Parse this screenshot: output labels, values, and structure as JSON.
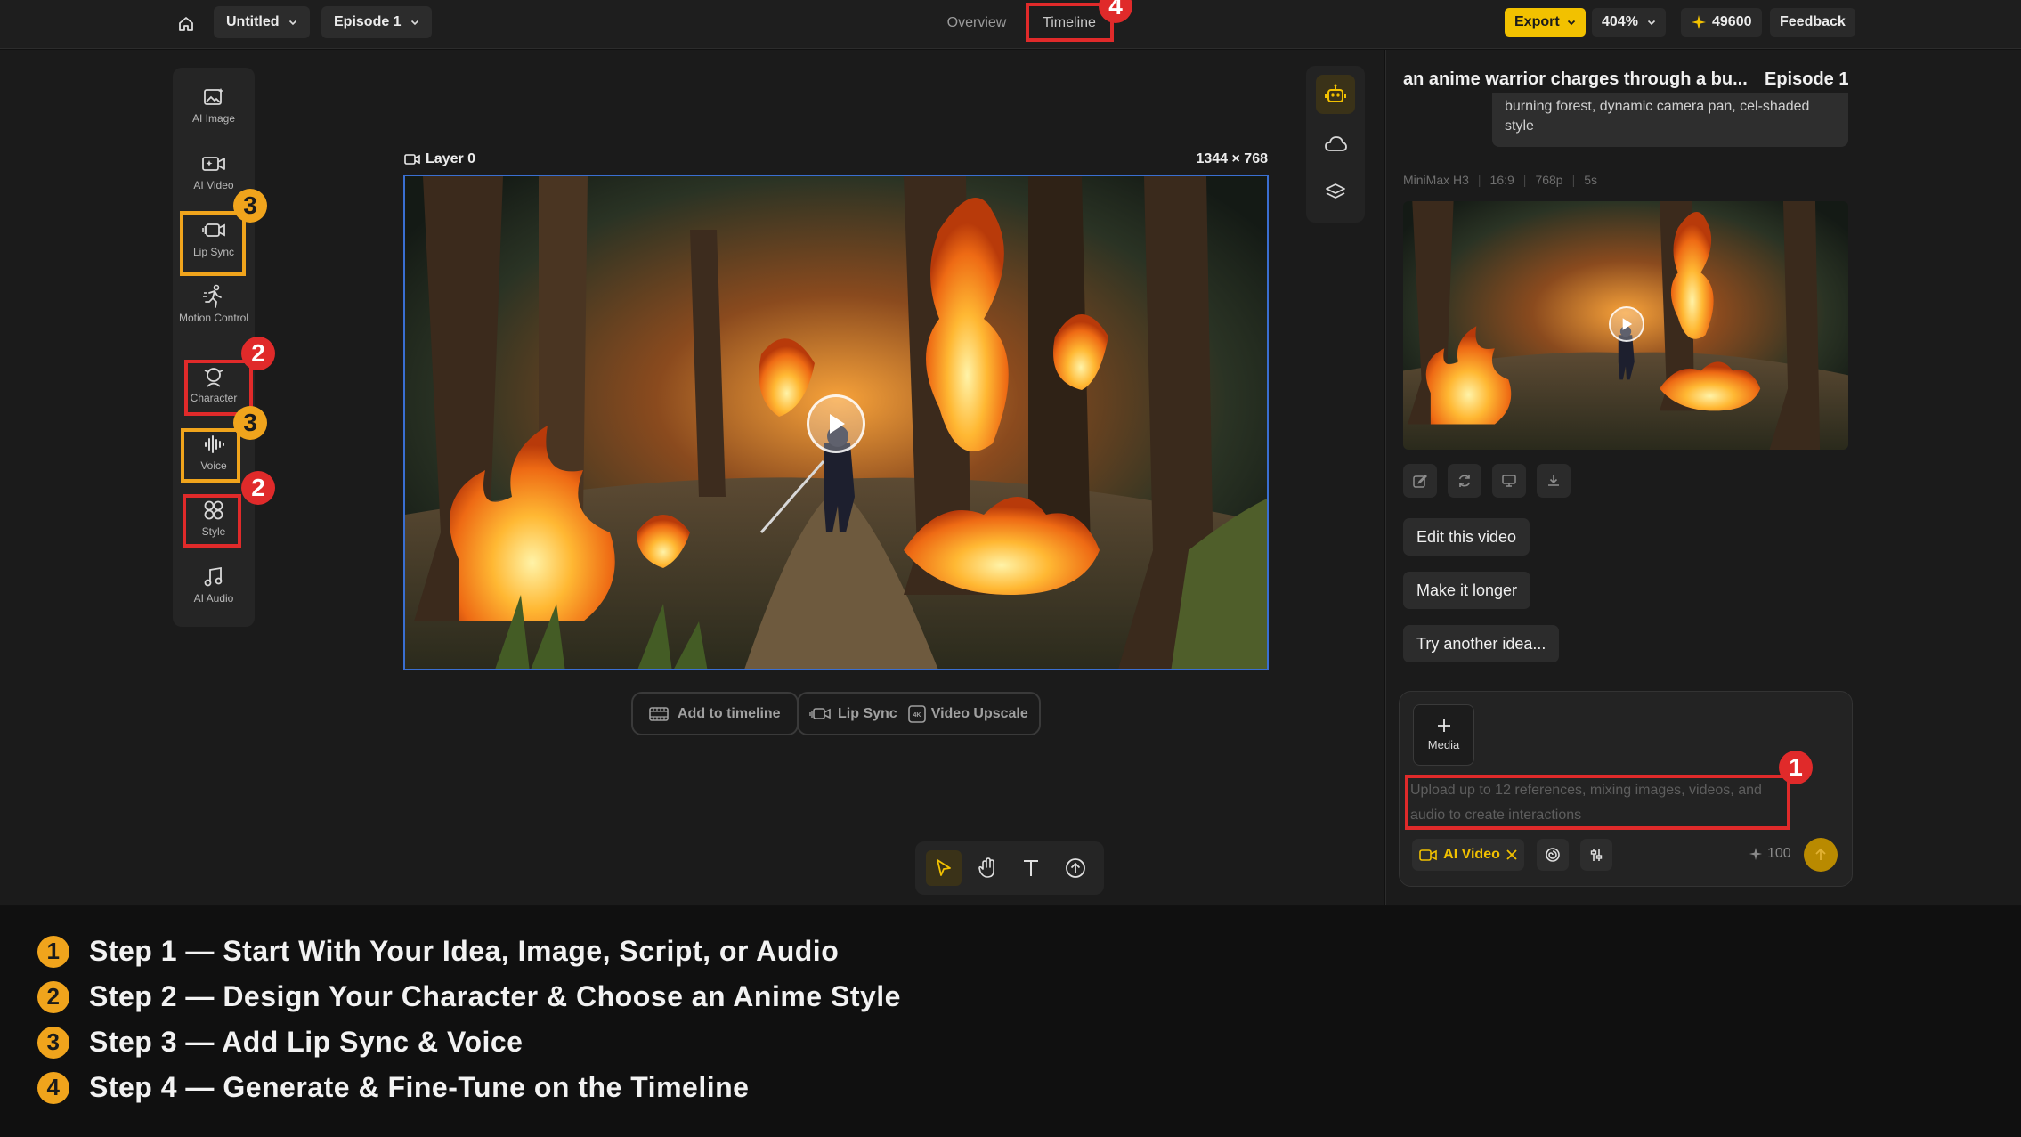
{
  "topbar": {
    "project": "Untitled",
    "episode": "Episode 1",
    "tabs": [
      "Overview",
      "Timeline"
    ],
    "export_label": "Export",
    "zoom": "404%",
    "credits": "49600",
    "feedback_label": "Feedback"
  },
  "tools": [
    {
      "label": "AI Image",
      "icon": "image-sparkle-icon"
    },
    {
      "label": "AI Video",
      "icon": "video-sparkle-icon"
    },
    {
      "label": "Lip Sync",
      "icon": "lip-sync-icon"
    },
    {
      "label": "Motion Control",
      "icon": "motion-icon"
    },
    {
      "label": "Character",
      "icon": "character-icon"
    },
    {
      "label": "Voice",
      "icon": "voice-wave-icon"
    },
    {
      "label": "Style",
      "icon": "style-icon"
    },
    {
      "label": "AI Audio",
      "icon": "music-note-icon"
    }
  ],
  "canvas": {
    "layer_label": "Layer 0",
    "dimensions": "1344 × 768",
    "add_to_timeline": "Add to timeline",
    "lip_sync": "Lip Sync",
    "video_upscale": "Video Upscale"
  },
  "panel": {
    "title": "an anime warrior charges through a bu...",
    "episode": "Episode 1",
    "prompt_tail": "burning forest, dynamic camera pan, cel-shaded style",
    "meta": [
      "MiniMax H3",
      "16:9",
      "768p",
      "5s"
    ],
    "suggestions": [
      "Edit this video",
      "Make it longer",
      "Try another idea..."
    ],
    "media_label": "Media",
    "input_placeholder": "Upload up to 12 references, mixing images, videos, and audio to create interactions",
    "mode_chip": "AI Video",
    "cost": "100"
  },
  "annotations": {
    "badges": [
      "1",
      "2",
      "2",
      "3",
      "3",
      "4"
    ],
    "colors": {
      "red": "#e02a2a",
      "yellow": "#f0a41c"
    }
  },
  "steps": [
    {
      "num": "1",
      "text": "Step 1 — Start With Your Idea, Image, Script, or Audio"
    },
    {
      "num": "2",
      "text": "Step 2 — Design Your Character & Choose an Anime Style"
    },
    {
      "num": "3",
      "text": "Step 3 — Add Lip Sync & Voice"
    },
    {
      "num": "4",
      "text": "Step 4 — Generate & Fine-Tune on the Timeline"
    }
  ]
}
